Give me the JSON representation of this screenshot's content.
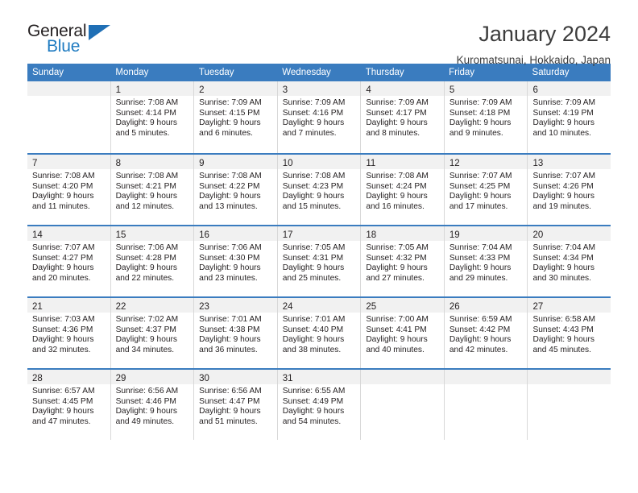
{
  "logo": {
    "word_top": "General",
    "word_bottom": "Blue",
    "triangle_color": "#1f6fb5",
    "blue_color": "#1f7bc1"
  },
  "header": {
    "title": "January 2024",
    "subtitle": "Kuromatsunai, Hokkaido, Japan"
  },
  "calendar": {
    "header_bg": "#3a7cbf",
    "row_divider_color": "#3a7cbf",
    "daynum_band_bg": "#f1f1f1",
    "weekday_headers": [
      "Sunday",
      "Monday",
      "Tuesday",
      "Wednesday",
      "Thursday",
      "Friday",
      "Saturday"
    ],
    "weeks": [
      [
        {
          "day": "",
          "sunrise": "",
          "sunset": "",
          "daylight_line1": "",
          "daylight_line2": ""
        },
        {
          "day": "1",
          "sunrise": "Sunrise: 7:08 AM",
          "sunset": "Sunset: 4:14 PM",
          "daylight_line1": "Daylight: 9 hours",
          "daylight_line2": "and 5 minutes."
        },
        {
          "day": "2",
          "sunrise": "Sunrise: 7:09 AM",
          "sunset": "Sunset: 4:15 PM",
          "daylight_line1": "Daylight: 9 hours",
          "daylight_line2": "and 6 minutes."
        },
        {
          "day": "3",
          "sunrise": "Sunrise: 7:09 AM",
          "sunset": "Sunset: 4:16 PM",
          "daylight_line1": "Daylight: 9 hours",
          "daylight_line2": "and 7 minutes."
        },
        {
          "day": "4",
          "sunrise": "Sunrise: 7:09 AM",
          "sunset": "Sunset: 4:17 PM",
          "daylight_line1": "Daylight: 9 hours",
          "daylight_line2": "and 8 minutes."
        },
        {
          "day": "5",
          "sunrise": "Sunrise: 7:09 AM",
          "sunset": "Sunset: 4:18 PM",
          "daylight_line1": "Daylight: 9 hours",
          "daylight_line2": "and 9 minutes."
        },
        {
          "day": "6",
          "sunrise": "Sunrise: 7:09 AM",
          "sunset": "Sunset: 4:19 PM",
          "daylight_line1": "Daylight: 9 hours",
          "daylight_line2": "and 10 minutes."
        }
      ],
      [
        {
          "day": "7",
          "sunrise": "Sunrise: 7:08 AM",
          "sunset": "Sunset: 4:20 PM",
          "daylight_line1": "Daylight: 9 hours",
          "daylight_line2": "and 11 minutes."
        },
        {
          "day": "8",
          "sunrise": "Sunrise: 7:08 AM",
          "sunset": "Sunset: 4:21 PM",
          "daylight_line1": "Daylight: 9 hours",
          "daylight_line2": "and 12 minutes."
        },
        {
          "day": "9",
          "sunrise": "Sunrise: 7:08 AM",
          "sunset": "Sunset: 4:22 PM",
          "daylight_line1": "Daylight: 9 hours",
          "daylight_line2": "and 13 minutes."
        },
        {
          "day": "10",
          "sunrise": "Sunrise: 7:08 AM",
          "sunset": "Sunset: 4:23 PM",
          "daylight_line1": "Daylight: 9 hours",
          "daylight_line2": "and 15 minutes."
        },
        {
          "day": "11",
          "sunrise": "Sunrise: 7:08 AM",
          "sunset": "Sunset: 4:24 PM",
          "daylight_line1": "Daylight: 9 hours",
          "daylight_line2": "and 16 minutes."
        },
        {
          "day": "12",
          "sunrise": "Sunrise: 7:07 AM",
          "sunset": "Sunset: 4:25 PM",
          "daylight_line1": "Daylight: 9 hours",
          "daylight_line2": "and 17 minutes."
        },
        {
          "day": "13",
          "sunrise": "Sunrise: 7:07 AM",
          "sunset": "Sunset: 4:26 PM",
          "daylight_line1": "Daylight: 9 hours",
          "daylight_line2": "and 19 minutes."
        }
      ],
      [
        {
          "day": "14",
          "sunrise": "Sunrise: 7:07 AM",
          "sunset": "Sunset: 4:27 PM",
          "daylight_line1": "Daylight: 9 hours",
          "daylight_line2": "and 20 minutes."
        },
        {
          "day": "15",
          "sunrise": "Sunrise: 7:06 AM",
          "sunset": "Sunset: 4:28 PM",
          "daylight_line1": "Daylight: 9 hours",
          "daylight_line2": "and 22 minutes."
        },
        {
          "day": "16",
          "sunrise": "Sunrise: 7:06 AM",
          "sunset": "Sunset: 4:30 PM",
          "daylight_line1": "Daylight: 9 hours",
          "daylight_line2": "and 23 minutes."
        },
        {
          "day": "17",
          "sunrise": "Sunrise: 7:05 AM",
          "sunset": "Sunset: 4:31 PM",
          "daylight_line1": "Daylight: 9 hours",
          "daylight_line2": "and 25 minutes."
        },
        {
          "day": "18",
          "sunrise": "Sunrise: 7:05 AM",
          "sunset": "Sunset: 4:32 PM",
          "daylight_line1": "Daylight: 9 hours",
          "daylight_line2": "and 27 minutes."
        },
        {
          "day": "19",
          "sunrise": "Sunrise: 7:04 AM",
          "sunset": "Sunset: 4:33 PM",
          "daylight_line1": "Daylight: 9 hours",
          "daylight_line2": "and 29 minutes."
        },
        {
          "day": "20",
          "sunrise": "Sunrise: 7:04 AM",
          "sunset": "Sunset: 4:34 PM",
          "daylight_line1": "Daylight: 9 hours",
          "daylight_line2": "and 30 minutes."
        }
      ],
      [
        {
          "day": "21",
          "sunrise": "Sunrise: 7:03 AM",
          "sunset": "Sunset: 4:36 PM",
          "daylight_line1": "Daylight: 9 hours",
          "daylight_line2": "and 32 minutes."
        },
        {
          "day": "22",
          "sunrise": "Sunrise: 7:02 AM",
          "sunset": "Sunset: 4:37 PM",
          "daylight_line1": "Daylight: 9 hours",
          "daylight_line2": "and 34 minutes."
        },
        {
          "day": "23",
          "sunrise": "Sunrise: 7:01 AM",
          "sunset": "Sunset: 4:38 PM",
          "daylight_line1": "Daylight: 9 hours",
          "daylight_line2": "and 36 minutes."
        },
        {
          "day": "24",
          "sunrise": "Sunrise: 7:01 AM",
          "sunset": "Sunset: 4:40 PM",
          "daylight_line1": "Daylight: 9 hours",
          "daylight_line2": "and 38 minutes."
        },
        {
          "day": "25",
          "sunrise": "Sunrise: 7:00 AM",
          "sunset": "Sunset: 4:41 PM",
          "daylight_line1": "Daylight: 9 hours",
          "daylight_line2": "and 40 minutes."
        },
        {
          "day": "26",
          "sunrise": "Sunrise: 6:59 AM",
          "sunset": "Sunset: 4:42 PM",
          "daylight_line1": "Daylight: 9 hours",
          "daylight_line2": "and 42 minutes."
        },
        {
          "day": "27",
          "sunrise": "Sunrise: 6:58 AM",
          "sunset": "Sunset: 4:43 PM",
          "daylight_line1": "Daylight: 9 hours",
          "daylight_line2": "and 45 minutes."
        }
      ],
      [
        {
          "day": "28",
          "sunrise": "Sunrise: 6:57 AM",
          "sunset": "Sunset: 4:45 PM",
          "daylight_line1": "Daylight: 9 hours",
          "daylight_line2": "and 47 minutes."
        },
        {
          "day": "29",
          "sunrise": "Sunrise: 6:56 AM",
          "sunset": "Sunset: 4:46 PM",
          "daylight_line1": "Daylight: 9 hours",
          "daylight_line2": "and 49 minutes."
        },
        {
          "day": "30",
          "sunrise": "Sunrise: 6:56 AM",
          "sunset": "Sunset: 4:47 PM",
          "daylight_line1": "Daylight: 9 hours",
          "daylight_line2": "and 51 minutes."
        },
        {
          "day": "31",
          "sunrise": "Sunrise: 6:55 AM",
          "sunset": "Sunset: 4:49 PM",
          "daylight_line1": "Daylight: 9 hours",
          "daylight_line2": "and 54 minutes."
        },
        {
          "day": "",
          "sunrise": "",
          "sunset": "",
          "daylight_line1": "",
          "daylight_line2": ""
        },
        {
          "day": "",
          "sunrise": "",
          "sunset": "",
          "daylight_line1": "",
          "daylight_line2": ""
        },
        {
          "day": "",
          "sunrise": "",
          "sunset": "",
          "daylight_line1": "",
          "daylight_line2": ""
        }
      ]
    ]
  }
}
